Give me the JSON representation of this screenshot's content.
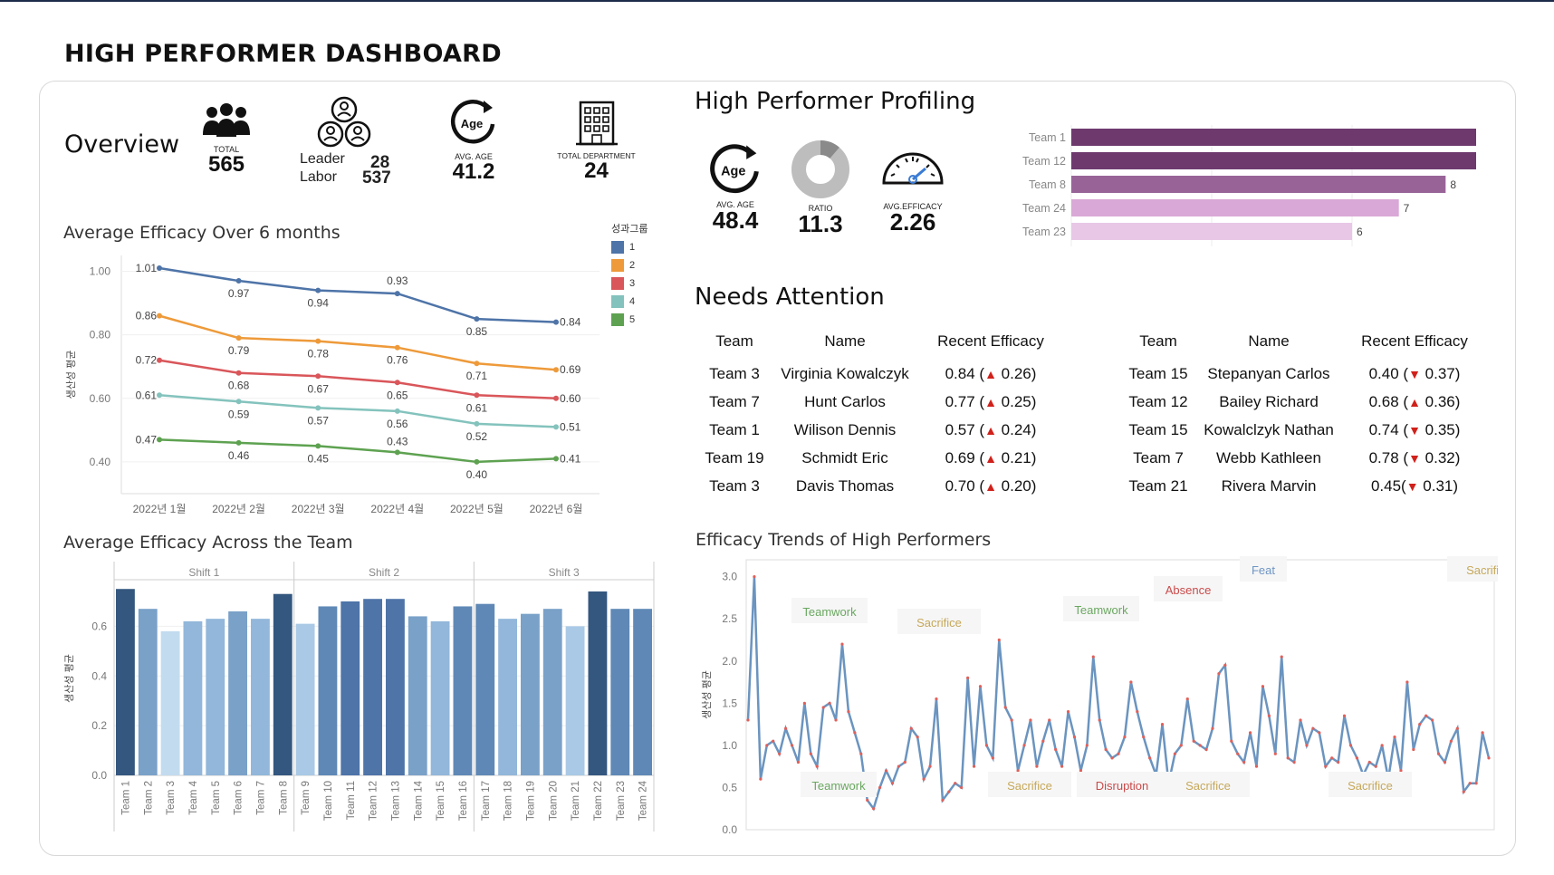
{
  "title": "HIGH PERFORMER DASHBOARD",
  "overview": {
    "heading": "Overview",
    "total": {
      "label": "TOTAL",
      "value": "565",
      "icon": "people-group-icon"
    },
    "leader": {
      "label": "Leader",
      "value": "28"
    },
    "labor": {
      "label": "Labor",
      "value": "537"
    },
    "avg_age": {
      "label": "AVG. AGE",
      "value": "41.2",
      "icon_text": "Age"
    },
    "departments": {
      "label": "TOTAL DEPARTMENT",
      "value": "24"
    }
  },
  "profiling": {
    "heading": "High Performer Profiling",
    "avg_age": {
      "label": "AVG. AGE",
      "value": "48.4",
      "icon_text": "Age"
    },
    "ratio": {
      "label": "RATIO",
      "value": "11.3",
      "fraction": 0.113
    },
    "avg_efficacy": {
      "label": "AVG.EFFICACY",
      "value": "2.26"
    },
    "team_bars": {
      "type": "bar",
      "categories": [
        "Team 1",
        "Team 12",
        "Team 8",
        "Team 24",
        "Team 23"
      ],
      "values": [
        9,
        9,
        8,
        7,
        6
      ],
      "colors": [
        "#6e3a6e",
        "#6e3a6e",
        "#986498",
        "#d9a8d6",
        "#e8c7e6"
      ]
    }
  },
  "needs_attention": {
    "heading": "Needs Attention",
    "headers": [
      "Team",
      "Name",
      "Recent Efficacy"
    ],
    "left": [
      {
        "team": "Team 3",
        "name": "Virginia Kowalczyk",
        "eff": "0.84 (",
        "delta": "0.26)",
        "dir": "up"
      },
      {
        "team": "Team 7",
        "name": "Hunt Carlos",
        "eff": "0.77 (",
        "delta": "0.25)",
        "dir": "up"
      },
      {
        "team": "Team 1",
        "name": "Wilison Dennis",
        "eff": "0.57 (",
        "delta": "0.24)",
        "dir": "up"
      },
      {
        "team": "Team 19",
        "name": "Schmidt Eric",
        "eff": "0.69 (",
        "delta": "0.21)",
        "dir": "up"
      },
      {
        "team": "Team 3",
        "name": "Davis Thomas",
        "eff": "0.70 (",
        "delta": "0.20)",
        "dir": "up"
      }
    ],
    "right": [
      {
        "team": "Team 15",
        "name": "Stepanyan Carlos",
        "eff": "0.40 (",
        "delta": "0.37)",
        "dir": "down"
      },
      {
        "team": "Team 12",
        "name": "Bailey Richard",
        "eff": "0.68 (",
        "delta": "0.36)",
        "dir": "up"
      },
      {
        "team": "Team 15",
        "name": "Kowalclzyk Nathan",
        "eff": "0.74 (",
        "delta": "0.35)",
        "dir": "down"
      },
      {
        "team": "Team 7",
        "name": "Webb Kathleen",
        "eff": "0.78 (",
        "delta": "0.32)",
        "dir": "down"
      },
      {
        "team": "Team 21",
        "name": "Rivera Marvin",
        "eff": "0.45(",
        "delta": "0.31)",
        "dir": "down"
      }
    ]
  },
  "line_chart": {
    "title": "Average Efficacy Over 6 months",
    "legend_title": "성과그룹",
    "chart_data": {
      "type": "line",
      "ylabel": "생산성 평균",
      "ylim": [
        0.3,
        1.05
      ],
      "yticks": [
        "0.40",
        "0.60",
        "0.80",
        "1.00"
      ],
      "categories": [
        "2022년 1월",
        "2022년 2월",
        "2022년 3월",
        "2022년 4월",
        "2022년 5월",
        "2022년 6월"
      ],
      "series": [
        {
          "name": "1",
          "color": "#4e74a8",
          "values": [
            1.01,
            0.97,
            0.94,
            0.93,
            0.85,
            0.84
          ]
        },
        {
          "name": "2",
          "color": "#ee9a3a",
          "values": [
            0.86,
            0.79,
            0.78,
            0.76,
            0.71,
            0.69
          ]
        },
        {
          "name": "3",
          "color": "#d9565a",
          "values": [
            0.72,
            0.68,
            0.67,
            0.65,
            0.61,
            0.6
          ]
        },
        {
          "name": "4",
          "color": "#84c3bd",
          "values": [
            0.61,
            0.59,
            0.57,
            0.56,
            0.52,
            0.51
          ]
        },
        {
          "name": "5",
          "color": "#5ea251",
          "values": [
            0.47,
            0.46,
            0.45,
            0.43,
            0.4,
            0.41
          ]
        }
      ]
    }
  },
  "team_chart": {
    "title": "Average Efficacy Across the Team",
    "chart_data": {
      "type": "bar",
      "ylabel": "생산성 평균",
      "ylim": [
        0,
        0.78
      ],
      "yticks": [
        "0.0",
        "0.2",
        "0.4",
        "0.6"
      ],
      "groups": [
        "Shift 1",
        "Shift 2",
        "Shift 3"
      ],
      "categories": [
        "Team 1",
        "Team 2",
        "Team 3",
        "Team 4",
        "Team 5",
        "Team 6",
        "Team 7",
        "Team 8",
        "Team 9",
        "Team 10",
        "Team 11",
        "Team 12",
        "Team 13",
        "Team 14",
        "Team 15",
        "Team 16",
        "Team 17",
        "Team 18",
        "Team 19",
        "Team 20",
        "Team 21",
        "Team 22",
        "Team 23",
        "Team 24"
      ],
      "values": [
        0.75,
        0.67,
        0.58,
        0.62,
        0.63,
        0.66,
        0.63,
        0.73,
        0.61,
        0.68,
        0.7,
        0.71,
        0.71,
        0.64,
        0.62,
        0.68,
        0.69,
        0.63,
        0.65,
        0.67,
        0.6,
        0.74,
        0.67,
        0.67
      ],
      "colors": [
        "#34577f",
        "#7aa1c8",
        "#c2dbef",
        "#92b7da",
        "#92b7da",
        "#7aa1c8",
        "#92b7da",
        "#34577f",
        "#a9c9e6",
        "#5f88b6",
        "#4e74a8",
        "#4e74a8",
        "#4e74a8",
        "#7aa1c8",
        "#92b7da",
        "#5f88b6",
        "#5f88b6",
        "#92b7da",
        "#7aa1c8",
        "#7aa1c8",
        "#a9c9e6",
        "#34577f",
        "#5f88b6",
        "#5f88b6"
      ]
    }
  },
  "trend_chart": {
    "title": "Efficacy Trends of High Performers",
    "chart_data": {
      "type": "line",
      "ylabel": "생산성 평균",
      "ylim": [
        0,
        3.2
      ],
      "yticks": [
        "0.0",
        "0.5",
        "1.0",
        "1.5",
        "2.0",
        "2.5",
        "3.0"
      ],
      "values": [
        1.3,
        3.0,
        0.6,
        1.0,
        1.05,
        0.9,
        1.2,
        1.0,
        0.8,
        1.5,
        0.9,
        0.75,
        1.45,
        1.5,
        1.3,
        2.2,
        1.4,
        1.15,
        0.9,
        0.35,
        0.25,
        0.5,
        0.7,
        0.55,
        0.75,
        0.8,
        1.2,
        1.1,
        0.6,
        0.75,
        1.55,
        0.35,
        0.45,
        0.55,
        0.5,
        1.8,
        0.75,
        1.7,
        1.0,
        0.85,
        2.25,
        1.45,
        1.3,
        0.7,
        1.0,
        1.3,
        0.75,
        1.05,
        1.3,
        0.95,
        0.75,
        1.4,
        1.1,
        0.7,
        1.0,
        2.05,
        1.3,
        0.95,
        0.85,
        0.9,
        1.1,
        1.75,
        1.4,
        1.1,
        0.85,
        0.65,
        1.25,
        0.55,
        0.9,
        1.0,
        1.55,
        1.05,
        1.0,
        0.95,
        1.2,
        1.85,
        1.95,
        1.05,
        0.9,
        0.8,
        1.15,
        0.75,
        1.7,
        1.35,
        0.9,
        2.05,
        0.85,
        0.8,
        1.3,
        1.0,
        1.2,
        1.15,
        0.75,
        0.85,
        0.8,
        1.35,
        1.0,
        0.85,
        0.65,
        0.8,
        0.75,
        1.0,
        0.6,
        1.1,
        0.7,
        1.75,
        0.95,
        1.25,
        1.35,
        1.3,
        0.9,
        0.8,
        1.05,
        1.2,
        0.45,
        0.55,
        0.55,
        1.15,
        0.85
      ],
      "annotations": [
        {
          "text": "Teamwork",
          "color": "#6aa860"
        },
        {
          "text": "Sacrifice",
          "color": "#c6a85a"
        },
        {
          "text": "Teamwork",
          "color": "#6aa860"
        },
        {
          "text": "Absence",
          "color": "#c94b4b"
        },
        {
          "text": "Feat",
          "color": "#6e95c4"
        },
        {
          "text": "Sacrifice",
          "color": "#c6a85a"
        },
        {
          "text": "Teamwork",
          "color": "#6aa860"
        },
        {
          "text": "Sacrifice",
          "color": "#c6a85a"
        },
        {
          "text": "Disruption",
          "color": "#c94b4b"
        },
        {
          "text": "Sacrifice",
          "color": "#c6a85a"
        },
        {
          "text": "Sacrifice",
          "color": "#c6a85a"
        }
      ]
    }
  }
}
